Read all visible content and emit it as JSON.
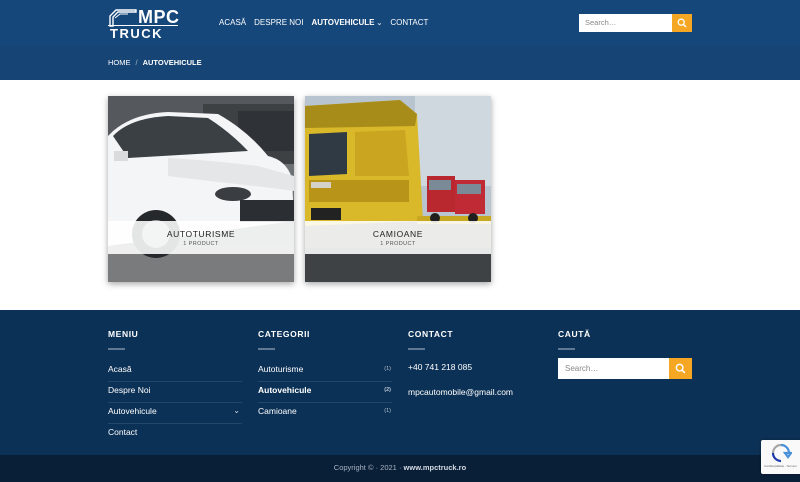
{
  "logo": {
    "line1": "MPC",
    "line2": "TRUCK"
  },
  "nav": {
    "items": [
      {
        "label": "Acasă"
      },
      {
        "label": "Despre Noi"
      },
      {
        "label": "Autovehicule"
      },
      {
        "label": "Contact"
      }
    ]
  },
  "search": {
    "placeholder": "Search…"
  },
  "breadcrumb": {
    "home": "Home",
    "separator": "/",
    "current": "Autovehicule"
  },
  "products": [
    {
      "name": "AUTOTURISME",
      "count": "1 PRODUCT"
    },
    {
      "name": "CAMIOANE",
      "count": "1 PRODUCT"
    }
  ],
  "footer": {
    "menu": {
      "title": "MENIU",
      "items": [
        "Acasă",
        "Despre Noi",
        "Autovehicule",
        "Contact"
      ]
    },
    "categories": {
      "title": "CATEGORII",
      "items": [
        {
          "label": "Autoturisme",
          "count": "(1)"
        },
        {
          "label": "Autovehicule",
          "count": "(2)"
        },
        {
          "label": "Camioane",
          "count": "(1)"
        }
      ]
    },
    "contact": {
      "title": "CONTACT",
      "phone": "+40 741 218 085",
      "email": "mpcautomobile@gmail.com"
    },
    "search": {
      "title": "CAUTĂ",
      "placeholder": "Search…"
    }
  },
  "copyright": {
    "text": "Copyright © · 2021 · ",
    "site": "www.mpctruck.ro"
  },
  "recaptcha": {
    "text": "Confidențialitate - Termeni"
  },
  "colors": {
    "header": "#16477a",
    "footer": "#0c3156",
    "accent": "#f5a623"
  },
  "icons": [
    "search-icon",
    "chevron-down-icon",
    "recaptcha-icon"
  ]
}
